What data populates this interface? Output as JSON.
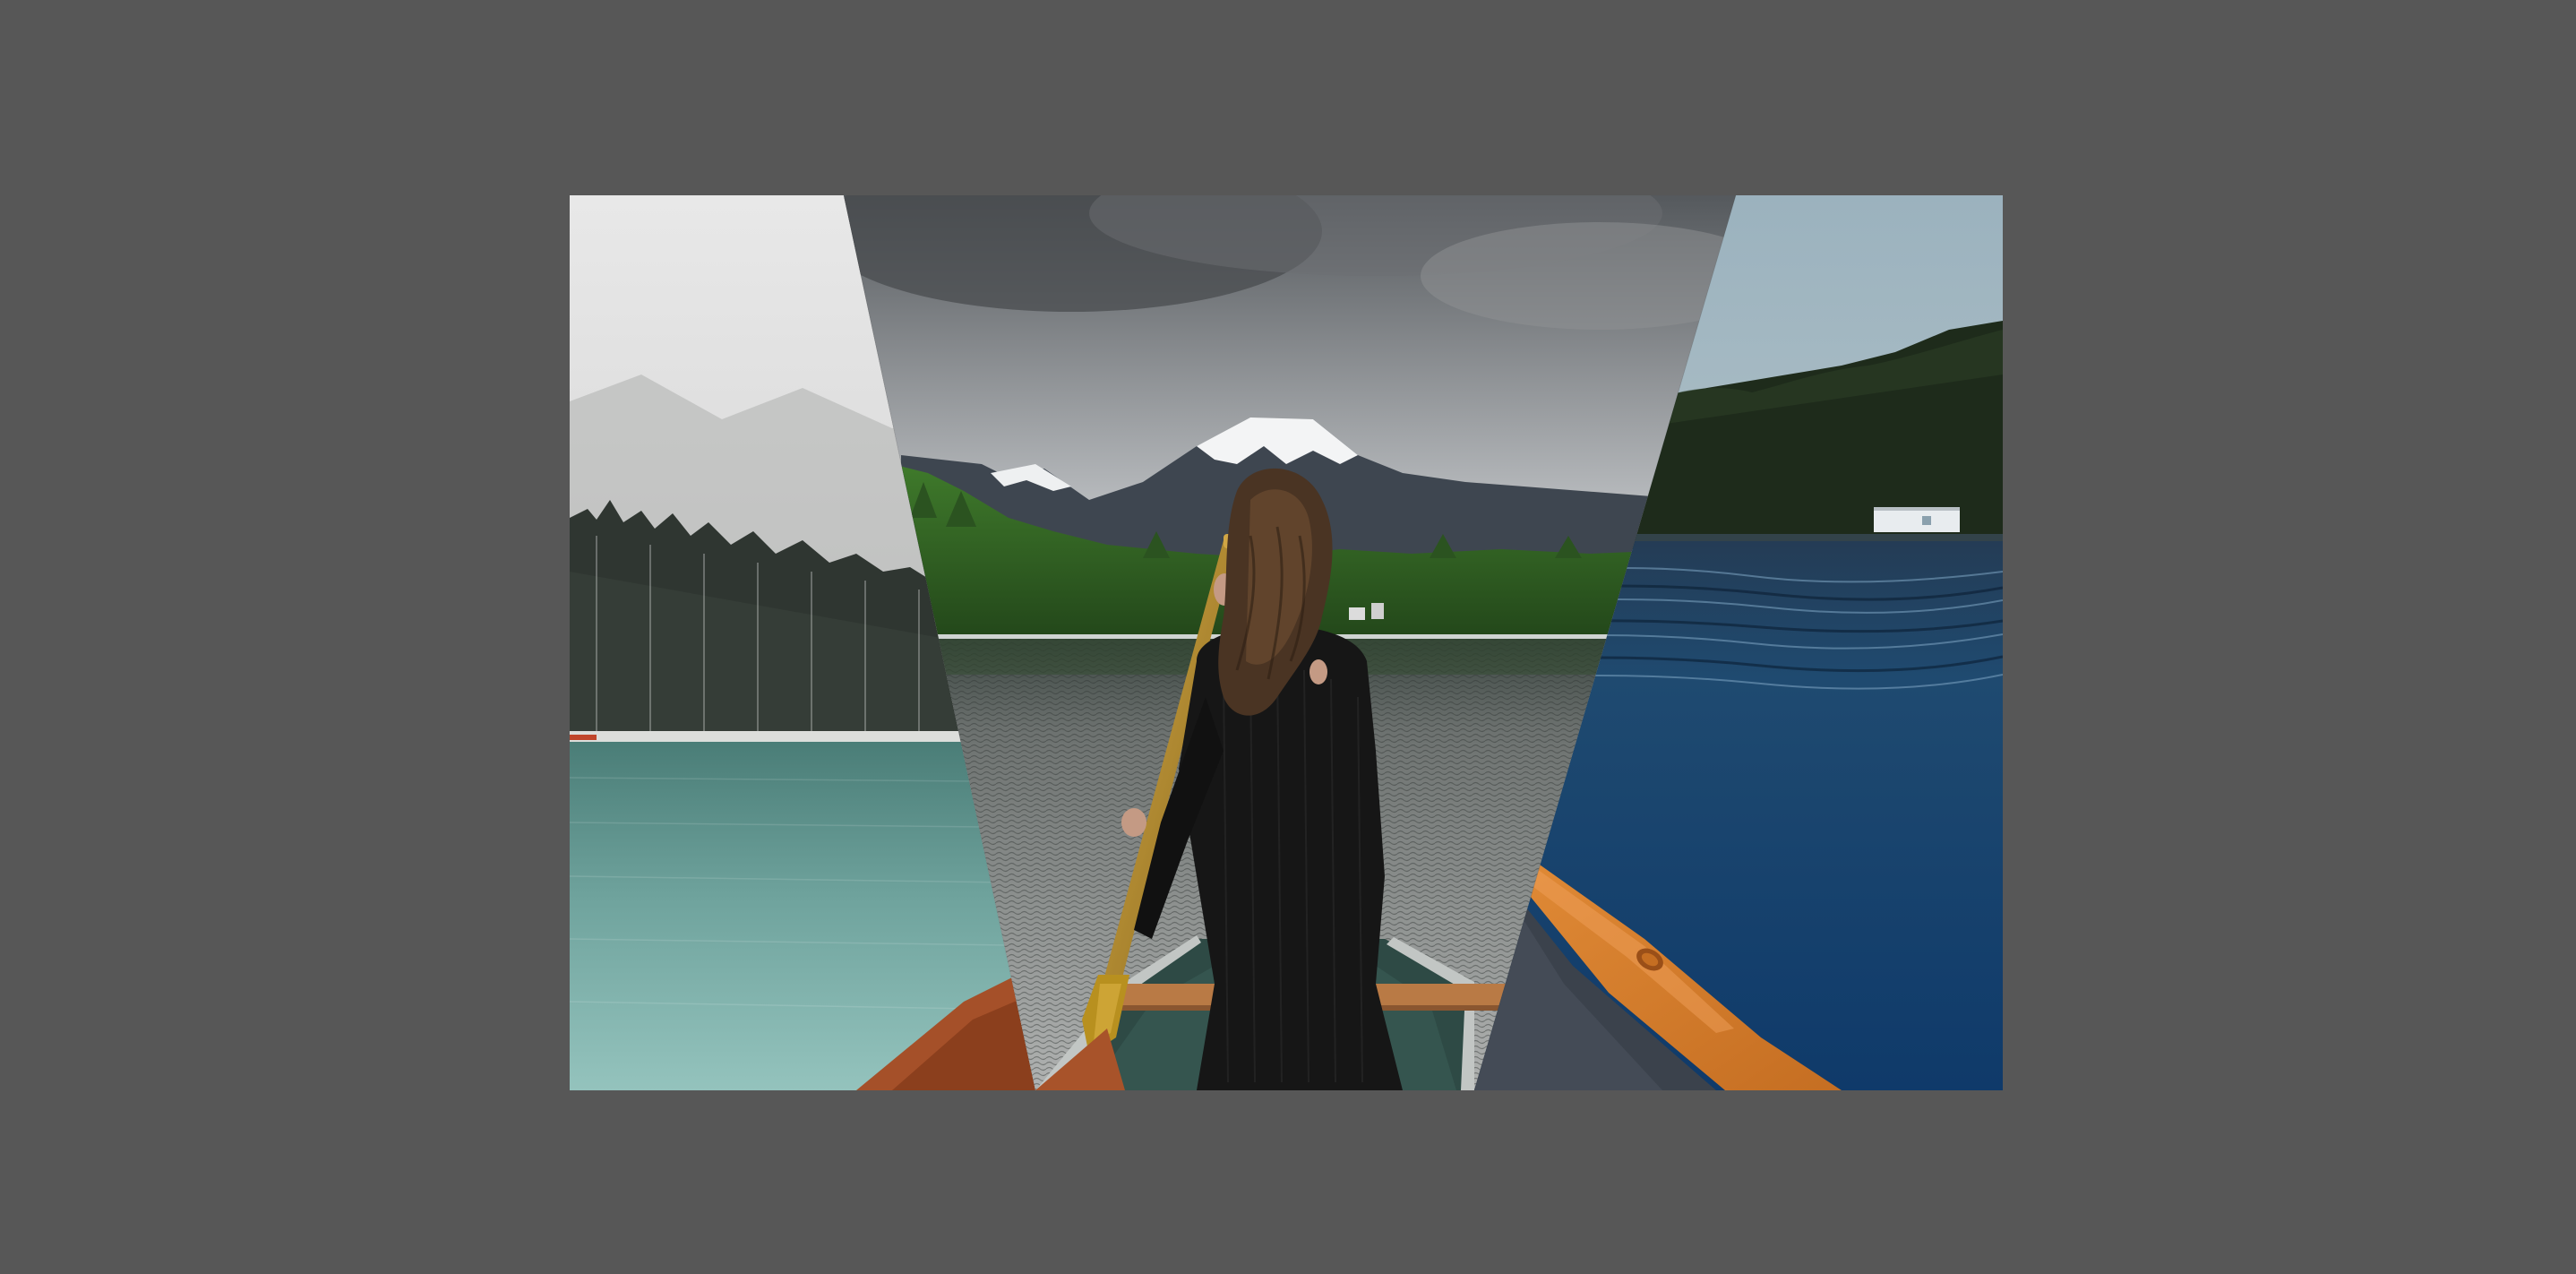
{
  "page": {
    "background_color": "#575757"
  },
  "slider": {
    "slide_count": 3,
    "slides": [
      {
        "id": "left",
        "scene": "misty-forest-lake",
        "palette": {
          "sky_top": "#e6e6e6",
          "sky_bottom": "#c9c9c9",
          "mountain": "#a9aaa9",
          "forest": "#2c332e",
          "shore": "#d9dbd8",
          "water_top": "#4b8079",
          "water_bottom": "#8fbfb8",
          "boat": "#a0502a"
        }
      },
      {
        "id": "center",
        "scene": "woman-paddling-canoe-mountain-lake",
        "palette": {
          "sky_top": "#4e5256",
          "sky_bottom": "#e9eaea",
          "snow": "#f2f3f4",
          "mountain": "#3e4650",
          "forest": "#2f5a23",
          "water_top": "#3b4440",
          "water_bottom": "#a5a7a6",
          "sweater": "#161616",
          "hair": "#4a3423",
          "paddle": "#b98d2c",
          "canoe_wood": "#a8532a",
          "canoe_inside": "#2e4a45"
        }
      },
      {
        "id": "right",
        "scene": "blue-lake-canoe-bow",
        "palette": {
          "sky_top": "#9db3bf",
          "sky_bottom": "#c7d2d3",
          "forest": "#1e2b1b",
          "building": "#e8ecef",
          "water_top": "#253f5c",
          "water_bottom": "#123a66",
          "canoe_inside": "#3b424c",
          "canoe_wood": "#d67d2b"
        }
      }
    ]
  }
}
